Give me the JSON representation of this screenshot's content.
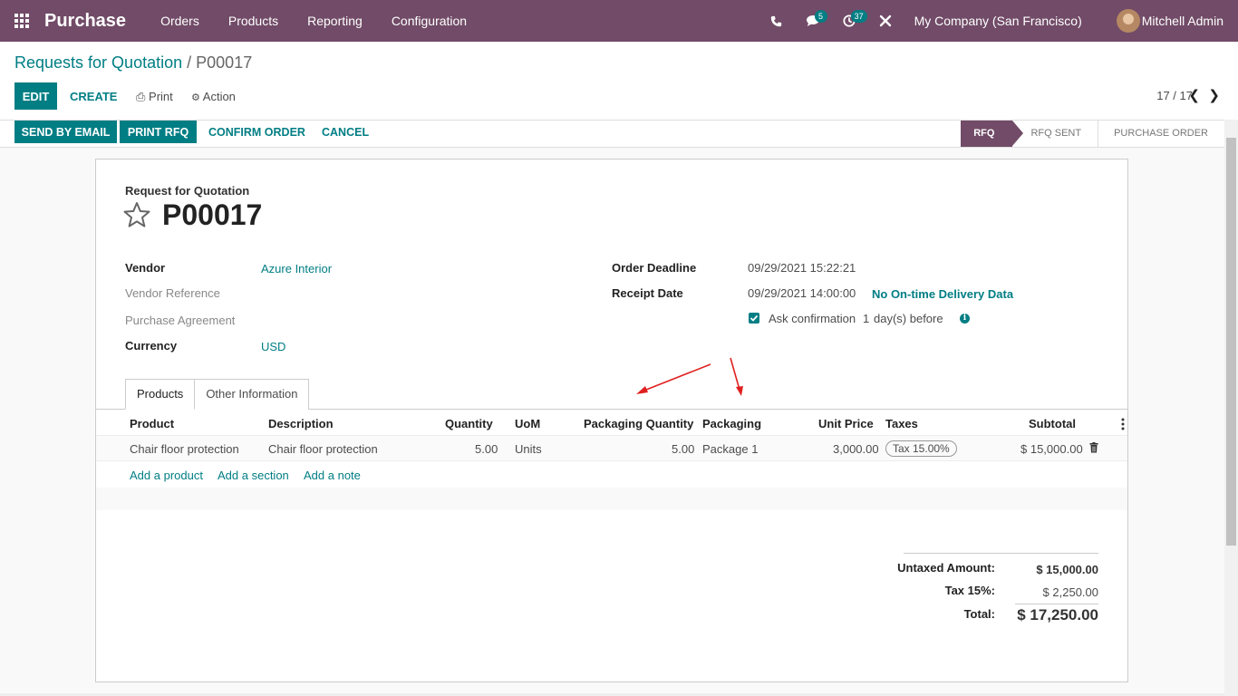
{
  "navbar": {
    "app_name": "Purchase",
    "menu": [
      "Orders",
      "Products",
      "Reporting",
      "Configuration"
    ],
    "messages_count": "5",
    "activities_count": "37",
    "company": "My Company (San Francisco)",
    "user": "Mitchell Admin"
  },
  "breadcrumb": {
    "parent": "Requests for Quotation",
    "separator": "/",
    "current": "P00017"
  },
  "toolbar": {
    "edit": "EDIT",
    "create": "CREATE",
    "print": "Print",
    "action": "Action",
    "pager": "17 / 17"
  },
  "header_buttons": {
    "send_email": "SEND BY EMAIL",
    "print_rfq": "PRINT RFQ",
    "confirm": "CONFIRM ORDER",
    "cancel": "CANCEL"
  },
  "stages": [
    "RFQ",
    "RFQ SENT",
    "PURCHASE ORDER"
  ],
  "form": {
    "doc_type": "Request for Quotation",
    "name": "P00017",
    "vendor_label": "Vendor",
    "vendor": "Azure Interior",
    "vendor_ref_label": "Vendor Reference",
    "agreement_label": "Purchase Agreement",
    "currency_label": "Currency",
    "currency": "USD",
    "deadline_label": "Order Deadline",
    "deadline": "09/29/2021 15:22:21",
    "receipt_label": "Receipt Date",
    "receipt": "09/29/2021 14:00:00",
    "ontime": "No On-time Delivery Data",
    "ask_conf": "Ask confirmation",
    "ask_days": "1",
    "ask_suffix": "day(s) before"
  },
  "tabs": [
    "Products",
    "Other Information"
  ],
  "lines": {
    "headers": [
      "Product",
      "Description",
      "Quantity",
      "UoM",
      "Packaging Quantity",
      "Packaging",
      "Unit Price",
      "Taxes",
      "Subtotal"
    ],
    "rows": [
      {
        "product": "Chair floor protection",
        "description": "Chair floor protection",
        "quantity": "5.00",
        "uom": "Units",
        "pkg_qty": "5.00",
        "packaging": "Package 1",
        "unit_price": "3,000.00",
        "taxes": "Tax 15.00%",
        "subtotal": "$ 15,000.00"
      }
    ],
    "add_product": "Add a product",
    "add_section": "Add a section",
    "add_note": "Add a note"
  },
  "totals": {
    "untaxed_label": "Untaxed Amount:",
    "untaxed": "$ 15,000.00",
    "tax_label": "Tax 15%:",
    "tax": "$ 2,250.00",
    "total_label": "Total:",
    "total": "$ 17,250.00"
  },
  "colors": {
    "brand": "#714b67",
    "accent": "#017e84",
    "annotation": "#e02020"
  }
}
